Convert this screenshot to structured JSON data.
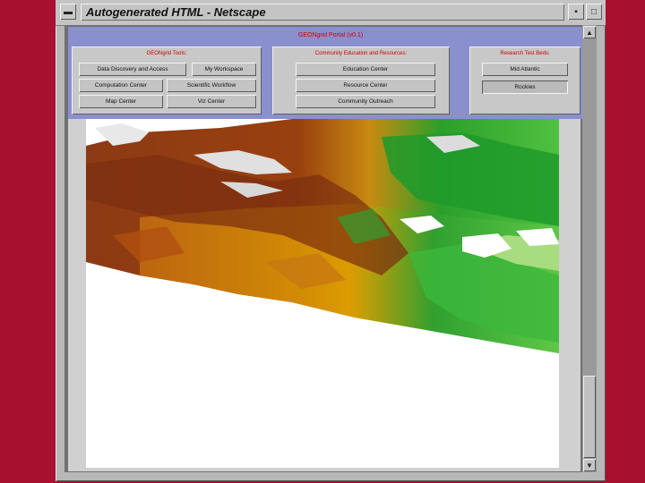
{
  "window": {
    "title": "Autogenerated HTML - Netscape",
    "controls": {
      "menu_icon": "window-menu-icon",
      "minimize": "minimize-icon",
      "maximize": "maximize-icon"
    }
  },
  "portal": {
    "title": "GEONgrid Portal (v0.1)",
    "tools": {
      "title": "GEONgrid Tools:",
      "data_discovery": "Data Discovery and Access",
      "workspace": "My Workspace",
      "computation": "Computation Center",
      "workflow": "Scientific Workflow",
      "map_center": "Map Center",
      "viz_center": "Viz Center"
    },
    "community": {
      "title": "Community Education and Resources:",
      "education": "Education Center",
      "resource": "Resource Center",
      "outreach": "Community Outreach"
    },
    "testbeds": {
      "title": "Research Test Beds:",
      "mid_atlantic": "Mid Atlantic",
      "rockies": "Rockies"
    }
  },
  "colors": {
    "desktop": "#a8102f",
    "header_bg": "#8a8fce",
    "panel_title": "#cc0000"
  }
}
